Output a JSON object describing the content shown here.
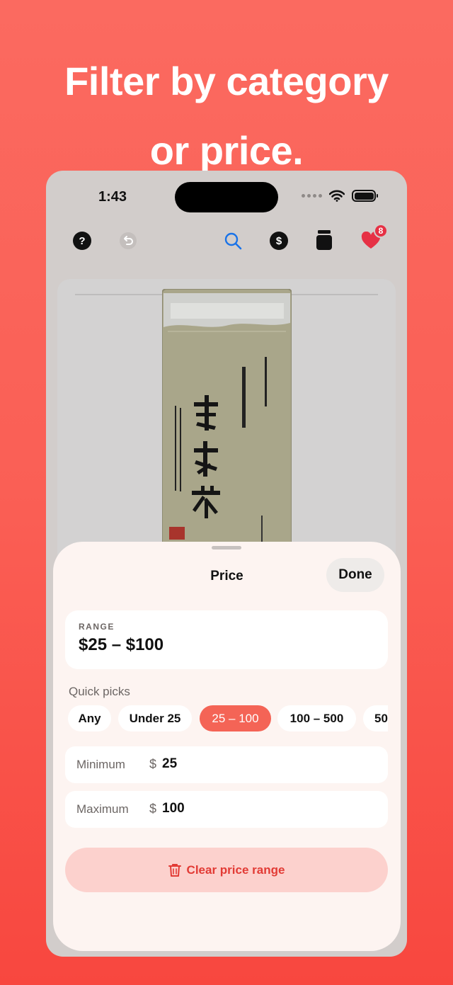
{
  "headline": {
    "line1": "Filter by category",
    "line2": "or price."
  },
  "status": {
    "time": "1:43"
  },
  "toolbar": {
    "favorites_count": "8",
    "dollar_glyph": "$",
    "help_glyph": "?"
  },
  "sheet": {
    "title": "Price",
    "done_label": "Done",
    "range": {
      "label": "RANGE",
      "value": "$25 – $100"
    },
    "quick_picks_label": "Quick picks",
    "quick_picks": [
      {
        "label": "Any",
        "selected": false
      },
      {
        "label": "Under 25",
        "selected": false
      },
      {
        "label": "25 – 100",
        "selected": true
      },
      {
        "label": "100 – 500",
        "selected": false
      },
      {
        "label": "50",
        "selected": false
      }
    ],
    "minimum": {
      "label": "Minimum",
      "currency": "$",
      "value": "25"
    },
    "maximum": {
      "label": "Maximum",
      "currency": "$",
      "value": "100"
    },
    "clear_label": "Clear price range"
  },
  "colors": {
    "accent": "#f46456",
    "destructive": "#e23b35",
    "background": "#fa5f55"
  }
}
